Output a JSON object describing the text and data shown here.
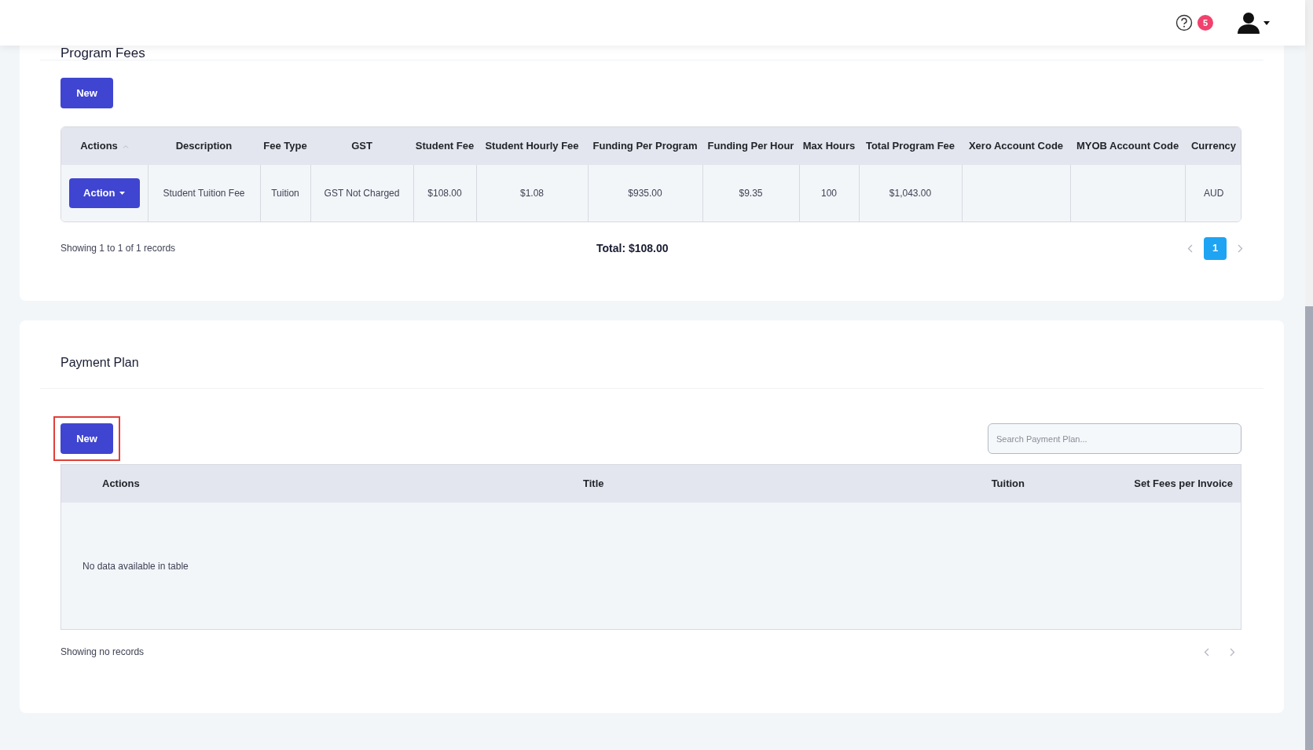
{
  "header": {
    "notification_count": "5"
  },
  "program_fees": {
    "title": "Program Fees",
    "new_button": {
      "label": "New",
      "highlighted": false
    },
    "columns": [
      {
        "label": "Actions",
        "sorted": true
      },
      {
        "label": "Description"
      },
      {
        "label": "Fee Type"
      },
      {
        "label": "GST"
      },
      {
        "label": "Student Fee"
      },
      {
        "label": "Student Hourly Fee"
      },
      {
        "label": "Funding Per Program"
      },
      {
        "label": "Funding Per Hour"
      },
      {
        "label": "Max Hours"
      },
      {
        "label": "Total Program Fee"
      },
      {
        "label": "Xero Account Code"
      },
      {
        "label": "MYOB Account Code"
      },
      {
        "label": "Currency"
      }
    ],
    "rows": [
      {
        "cells": [
          "Action",
          "Student Tuition Fee",
          "Tuition",
          "GST Not Charged",
          "$108.00",
          "$1.08",
          "$935.00",
          "$9.35",
          "100",
          "$1,043.00",
          "",
          "",
          "AUD"
        ]
      }
    ],
    "info": "Showing 1 to 1 of 1 records",
    "total": "Total: $108.00",
    "pages": [
      {
        "label": "1",
        "selected": true
      }
    ]
  },
  "payment_plan": {
    "title": "Payment Plan",
    "new_button": {
      "label": "New",
      "highlighted": true
    },
    "search": {
      "placeholder": "Search Payment Plan..."
    },
    "columns": [
      "Actions",
      "Title",
      "Tuition",
      "Set Fees per Invoice"
    ],
    "empty": "No data available in table",
    "info": "Showing no records"
  }
}
